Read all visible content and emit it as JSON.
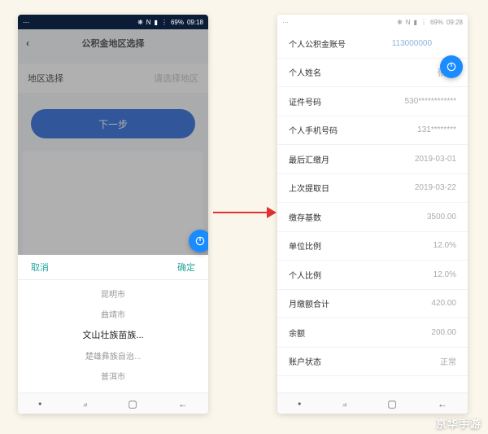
{
  "status": {
    "icons_text": "⋯",
    "bt": "❋",
    "nfc": "N",
    "sig": "▮",
    "wifi": "⋮",
    "battery": "69%",
    "time_left": "09:18",
    "time_right": "09:28"
  },
  "left_phone": {
    "header_title": "公积金地区选择",
    "region_label": "地区选择",
    "region_value": "请选择地区",
    "next_button": "下一步",
    "picker": {
      "cancel": "取消",
      "confirm": "确定",
      "items": [
        "昆明市",
        "曲靖市",
        "文山壮族苗族...",
        "楚雄彝族自治...",
        "普洱市"
      ],
      "selected_index": 2
    }
  },
  "arrow_label": "→",
  "right_phone": {
    "rows": [
      {
        "label": "个人公积金账号",
        "value": "113000000"
      },
      {
        "label": "个人姓名",
        "value": "张XX"
      },
      {
        "label": "证件号码",
        "value": "530************"
      },
      {
        "label": "个人手机号码",
        "value": "131********"
      },
      {
        "label": "最后汇缴月",
        "value": "2019-03-01"
      },
      {
        "label": "上次提取日",
        "value": "2019-03-22"
      },
      {
        "label": "缴存基数",
        "value": "3500.00"
      },
      {
        "label": "单位比例",
        "value": "12.0%"
      },
      {
        "label": "个人比例",
        "value": "12.0%"
      },
      {
        "label": "月缴额合计",
        "value": "420.00"
      },
      {
        "label": "余额",
        "value": "200.00"
      },
      {
        "label": "账户状态",
        "value": "正常"
      }
    ]
  },
  "nav": {
    "dot": "•",
    "recent": "⟓",
    "home": "▢",
    "back": "←"
  },
  "watermark": "京华手游"
}
